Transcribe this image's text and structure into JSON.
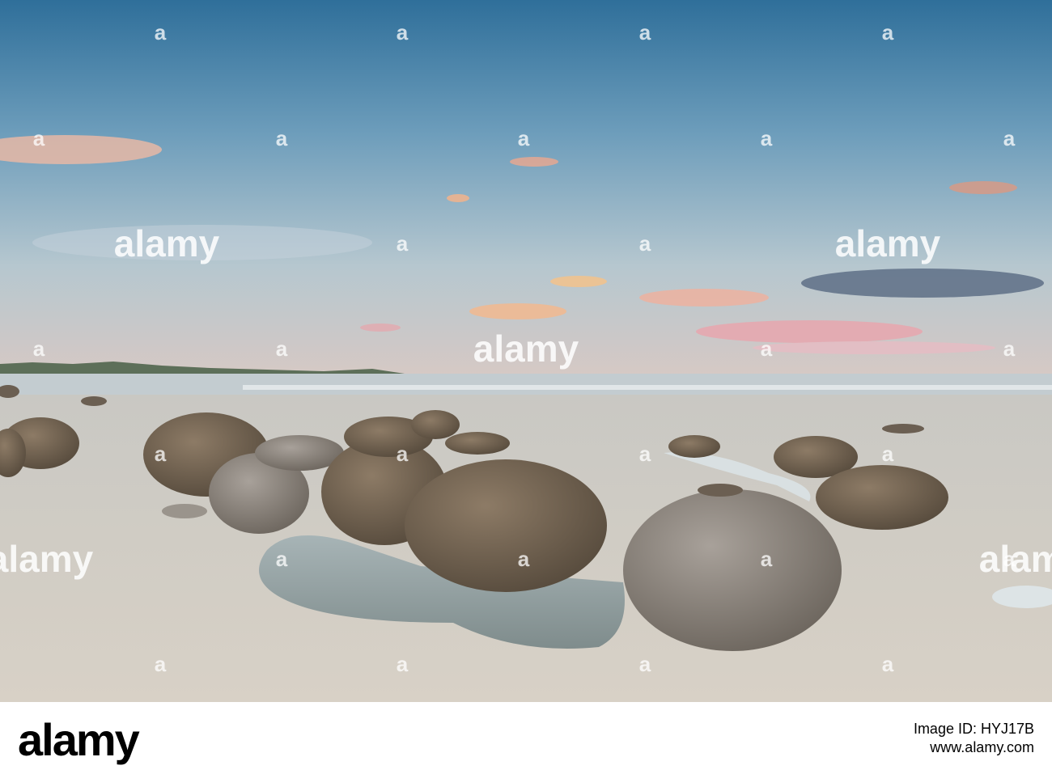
{
  "watermark": {
    "text": "alamy",
    "mark": "a"
  },
  "footer": {
    "brand": "alamy",
    "image_id_label": "Image ID: HYJ17B",
    "url": "www.alamy.com"
  },
  "colors": {
    "sky_top": "#3f7ea6",
    "sky_mid": "#8fb3c8",
    "horizon": "#d9b5b0",
    "sand": "#cfc9bf",
    "boulder": "#7a6a58"
  }
}
